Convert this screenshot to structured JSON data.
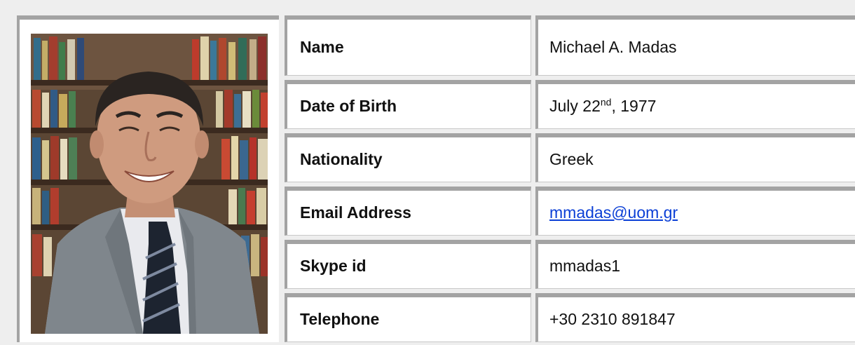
{
  "profile": {
    "photo_alt": "",
    "rows": [
      {
        "label": "Name",
        "value": "Michael A. Madas"
      },
      {
        "label": "Date of Birth",
        "value_prefix": "July 22",
        "value_sup": "nd",
        "value_suffix": ", 1977"
      },
      {
        "label": "Nationality",
        "value": "Greek"
      },
      {
        "label": "Email Address",
        "value": "mmadas@uom.gr"
      },
      {
        "label": "Skype id",
        "value": "mmadas1"
      },
      {
        "label": "Telephone",
        "value": "+30 2310 891847"
      }
    ]
  },
  "colors": {
    "background": "#eeeeee",
    "cell_border": "#a3a3a3",
    "link": "#0b3fd6"
  }
}
